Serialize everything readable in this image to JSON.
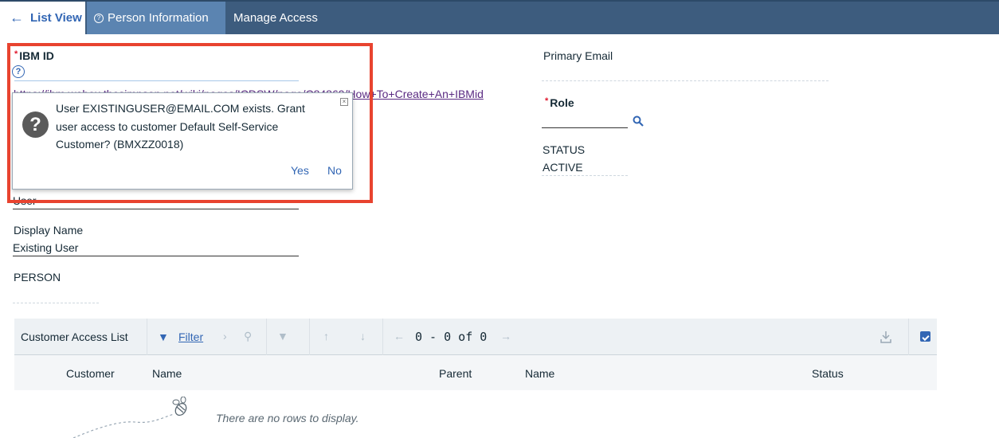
{
  "nav": {
    "list_view": "List View",
    "person_info": "Person Information",
    "manage_access": "Manage Access"
  },
  "form": {
    "ibm_id_label": "IBM ID",
    "help_link": "https://ibm.webex.thesimpson.net/wiki/pages/ICDSW/page/C84869/How+To+Create+An+IBMid",
    "user_partial": "User",
    "display_name_label": "Display Name",
    "display_name_value": "Existing User",
    "person_label": "PERSON",
    "primary_email_label": "Primary Email",
    "role_label": "Role",
    "status_label": "STATUS",
    "status_value": "ACTIVE"
  },
  "dialog": {
    "message": "User EXISTINGUSER@EMAIL.COM exists. Grant user access to customer Default Self-Service Customer? (BMXZZ0018)",
    "yes": "Yes",
    "no": "No"
  },
  "table": {
    "title": "Customer Access List",
    "filter": "Filter",
    "pager": "0 - 0 of 0",
    "columns": [
      "Customer",
      "Name",
      "Parent",
      "Name",
      "Status"
    ],
    "empty": "There are no rows to display."
  },
  "colors": {
    "nav_bg": "#3d5c7e",
    "active_tab": "#5b84b1",
    "accent": "#3266b4",
    "highlight": "#e8432f"
  }
}
